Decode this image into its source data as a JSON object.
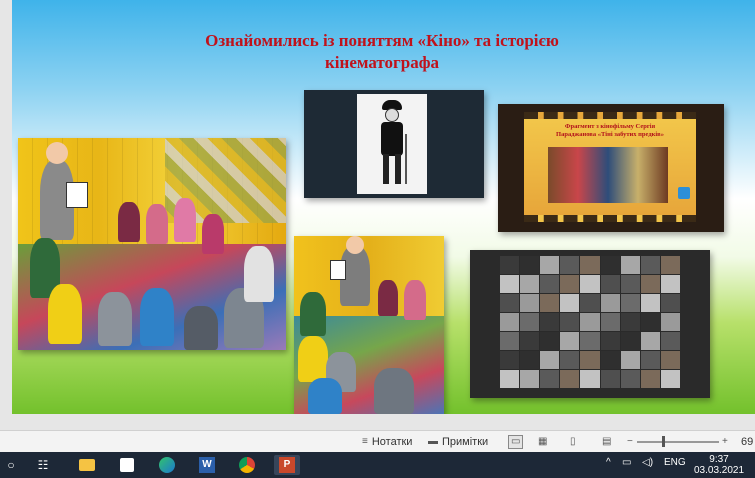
{
  "slide": {
    "title_line1": "Ознайомились із поняттям «Кіно» та історією",
    "title_line2": "кінематографа"
  },
  "photos": {
    "film_fragment_title_line1": "Фрагмент з кінофільму Сергія",
    "film_fragment_title_line2": "Параджанова «Тіні забутих предків»"
  },
  "status_bar": {
    "notes_label": "Нотатки",
    "comments_label": "Примітки",
    "zoom_value": "69"
  },
  "taskbar": {
    "apps": [
      "start",
      "task-view",
      "file-explorer",
      "store",
      "edge",
      "word",
      "chrome",
      "powerpoint"
    ],
    "language": "ENG",
    "time": "9:37",
    "date": "03.03.2021"
  },
  "colors": {
    "title": "#c0121b",
    "taskbar_bg": "#1d2837",
    "statusbar_bg": "#f3f3f3"
  }
}
